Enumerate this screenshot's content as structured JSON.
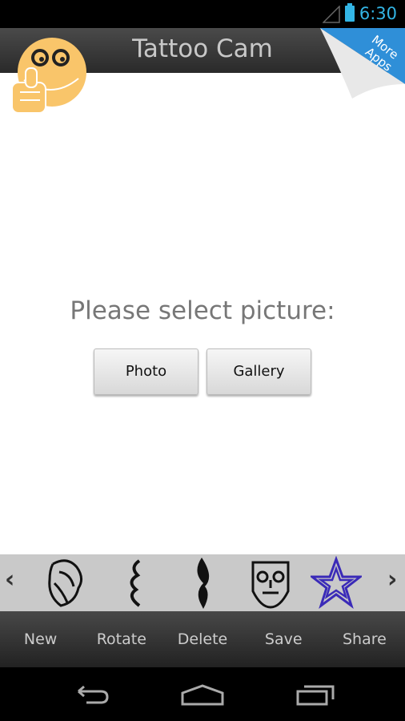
{
  "status_bar": {
    "time": "6:30"
  },
  "header": {
    "title": "Tattoo Cam",
    "more_apps": [
      "More",
      "Apps"
    ]
  },
  "main": {
    "prompt": "Please select picture:",
    "photo_button": "Photo",
    "gallery_button": "Gallery"
  },
  "tattoo_strip": {
    "items": [
      "lion",
      "dragon",
      "tribal",
      "mask",
      "star"
    ],
    "star_color": "#3a2ab8"
  },
  "toolbar": {
    "items": [
      "New",
      "Rotate",
      "Delete",
      "Save",
      "Share"
    ]
  },
  "colors": {
    "accent": "#33b5e5",
    "smiley": "#f9c56a",
    "ribbon": "#2f8fd8"
  }
}
